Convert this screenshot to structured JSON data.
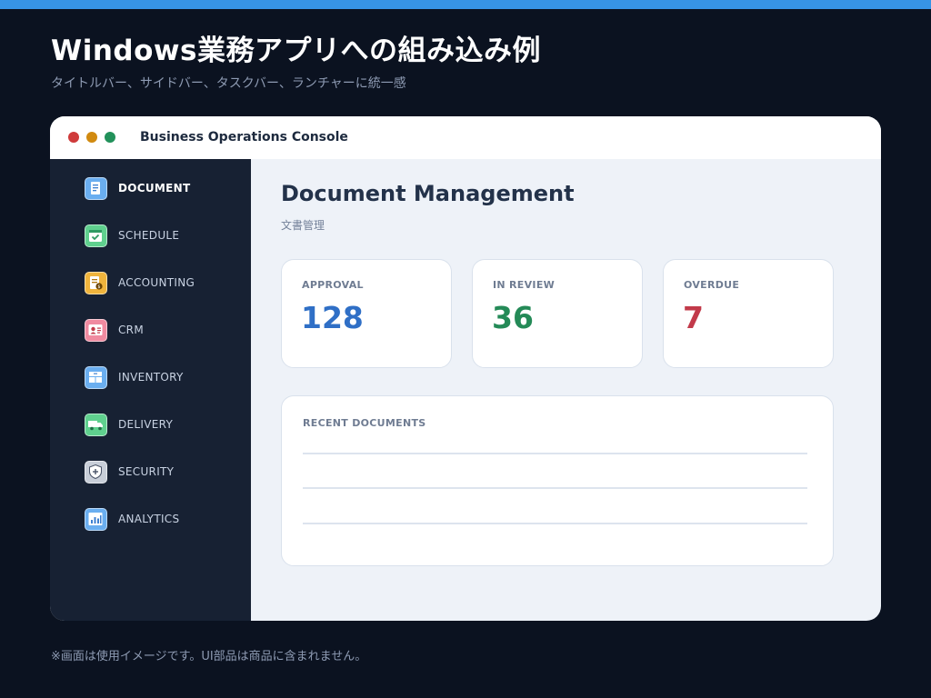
{
  "page": {
    "headline": "Windows業務アプリへの組み込み例",
    "subline": "タイトルバー、サイドバー、タスクバー、ランチャーに統一感",
    "footnote": "※画面は使用イメージです。UI部品は商品に含まれません。",
    "accent_color": "#3794e6",
    "background_color": "#0b1220"
  },
  "window": {
    "title": "Business Operations Console",
    "controls": [
      {
        "name": "close",
        "color": "#cf3b3b"
      },
      {
        "name": "minimize",
        "color": "#d18a10"
      },
      {
        "name": "maximize",
        "color": "#22915a"
      }
    ]
  },
  "sidebar": {
    "items": [
      {
        "label": "DOCUMENT",
        "icon": "document-icon",
        "color": "#6aaef0",
        "active": true
      },
      {
        "label": "SCHEDULE",
        "icon": "calendar-check-icon",
        "color": "#5fd08e",
        "active": false
      },
      {
        "label": "ACCOUNTING",
        "icon": "ledger-coin-icon",
        "color": "#f0b43c",
        "active": false
      },
      {
        "label": "CRM",
        "icon": "contact-card-icon",
        "color": "#f08aa0",
        "active": false
      },
      {
        "label": "INVENTORY",
        "icon": "boxes-icon",
        "color": "#6aaef0",
        "active": false
      },
      {
        "label": "DELIVERY",
        "icon": "truck-icon",
        "color": "#5fd08e",
        "active": false
      },
      {
        "label": "SECURITY",
        "icon": "shield-icon",
        "color": "#c8ced8",
        "active": false
      },
      {
        "label": "ANALYTICS",
        "icon": "bar-chart-icon",
        "color": "#6aaef0",
        "active": false
      }
    ]
  },
  "main": {
    "title": "Document Management",
    "subtitle": "文書管理",
    "stats": [
      {
        "label": "APPROVAL",
        "value": "128",
        "color": "#2f6fc6"
      },
      {
        "label": "IN REVIEW",
        "value": "36",
        "color": "#248a57"
      },
      {
        "label": "OVERDUE",
        "value": "7",
        "color": "#c23a4a"
      }
    ],
    "recent": {
      "label": "RECENT DOCUMENTS"
    }
  }
}
